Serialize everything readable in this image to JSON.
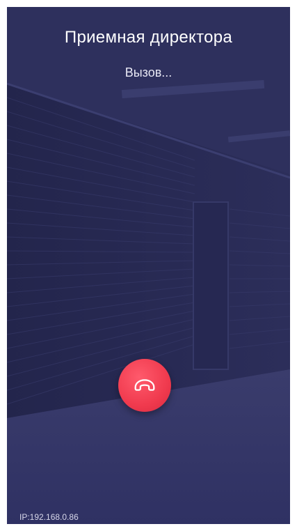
{
  "call": {
    "caller_name": "Приемная директора",
    "status": "Вызов..."
  },
  "controls": {
    "hangup_icon": "phone-hangup-icon",
    "hangup_color": "#f03a4e"
  },
  "footer": {
    "ip": "IP:192.168.0.86"
  },
  "colors": {
    "overlay": "#2c2e58",
    "text": "#ffffff"
  }
}
